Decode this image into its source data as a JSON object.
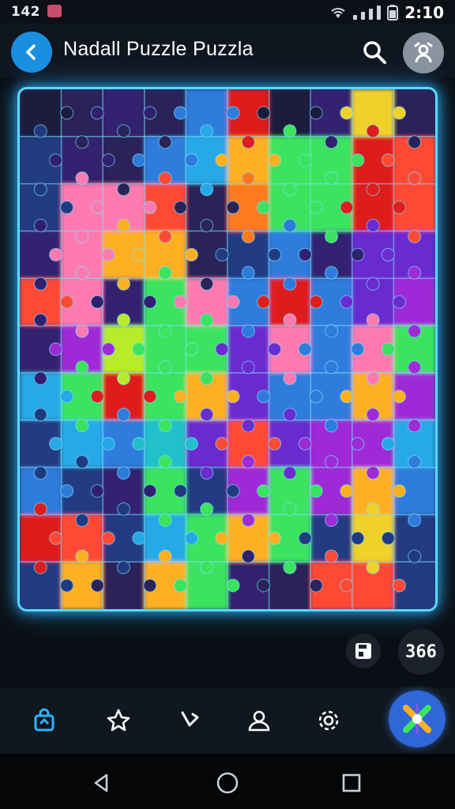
{
  "status_bar": {
    "left_text": "142",
    "time": "2:10",
    "icons": [
      "wifi-icon",
      "signal-icon",
      "battery-icon"
    ]
  },
  "header": {
    "title": "Nadall Puzzle Puzzla",
    "back_icon": "chevron-left-icon",
    "search_icon": "search-icon",
    "profile_icon": "avatar-icon"
  },
  "board": {
    "columns": 10,
    "rows": 11,
    "palette": [
      "#1a1a3d",
      "#2a2359",
      "#312070",
      "#203a82",
      "#2e7bdc",
      "#25a9e6",
      "#21c0c9",
      "#3be35f",
      "#5cd21d",
      "#b7ec2c",
      "#f0d12a",
      "#ffb020",
      "#ff7a1f",
      "#ff4a36",
      "#de1d1d",
      "#ff7ab0",
      "#9d2bd6",
      "#6a2bd0"
    ],
    "grid": [
      [
        0,
        1,
        2,
        1,
        4,
        14,
        0,
        2,
        10,
        1
      ],
      [
        3,
        2,
        1,
        4,
        5,
        11,
        7,
        7,
        14,
        13
      ],
      [
        3,
        15,
        15,
        13,
        1,
        12,
        7,
        7,
        14,
        13
      ],
      [
        2,
        15,
        11,
        11,
        1,
        3,
        4,
        2,
        17,
        17
      ],
      [
        13,
        15,
        2,
        7,
        15,
        4,
        14,
        4,
        17,
        16
      ],
      [
        2,
        16,
        9,
        7,
        7,
        17,
        15,
        4,
        15,
        7
      ],
      [
        5,
        7,
        14,
        7,
        11,
        17,
        4,
        4,
        11,
        16
      ],
      [
        3,
        5,
        4,
        6,
        17,
        13,
        17,
        16,
        16,
        5
      ],
      [
        4,
        3,
        2,
        7,
        3,
        16,
        7,
        16,
        11,
        4
      ],
      [
        14,
        13,
        3,
        5,
        7,
        11,
        7,
        3,
        10,
        3
      ],
      [
        3,
        11,
        1,
        11,
        7,
        2,
        1,
        13,
        13,
        3
      ]
    ]
  },
  "controls": {
    "save_icon": "save-icon",
    "counter": "366"
  },
  "bottom_nav": {
    "items": [
      {
        "icon": "bag-icon",
        "active": true
      },
      {
        "icon": "star-icon",
        "active": false
      },
      {
        "icon": "bookmark-icon",
        "active": false
      },
      {
        "icon": "profile-icon",
        "active": false
      },
      {
        "icon": "settings-icon",
        "active": false
      }
    ],
    "fab_icon": "puzzle-logo-icon"
  },
  "system_nav": [
    "back-triangle-icon",
    "home-circle-icon",
    "recents-square-icon"
  ],
  "colors": {
    "accent": "#1a8fe0",
    "glow": "#59d7ff",
    "active_nav": "#2fb2ff"
  }
}
